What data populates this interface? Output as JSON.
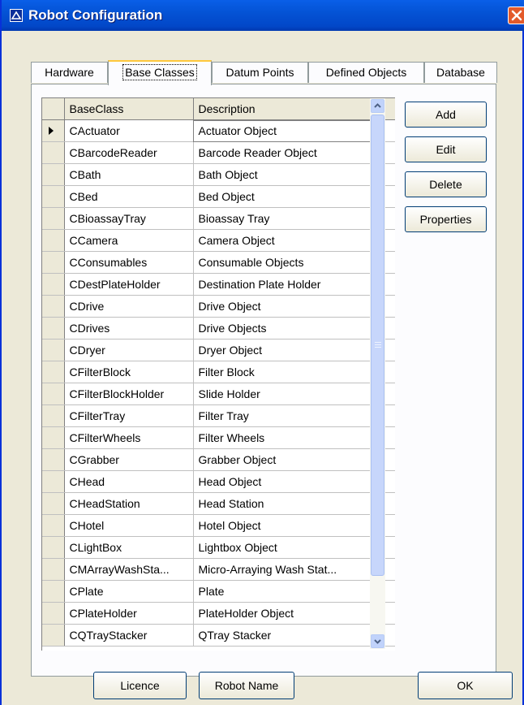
{
  "window": {
    "title": "Robot Configuration"
  },
  "tabs": [
    {
      "label": "Hardware"
    },
    {
      "label": "Base Classes"
    },
    {
      "label": "Datum Points"
    },
    {
      "label": "Defined Objects"
    },
    {
      "label": "Database"
    }
  ],
  "active_tab": "Base Classes",
  "grid": {
    "columns": [
      "BaseClass",
      "Description"
    ],
    "rows": [
      [
        "CActuator",
        "Actuator Object"
      ],
      [
        "CBarcodeReader",
        "Barcode Reader Object"
      ],
      [
        "CBath",
        "Bath Object"
      ],
      [
        "CBed",
        "Bed Object"
      ],
      [
        "CBioassayTray",
        "Bioassay Tray"
      ],
      [
        "CCamera",
        "Camera Object"
      ],
      [
        "CConsumables",
        "Consumable Objects"
      ],
      [
        "CDestPlateHolder",
        "Destination Plate Holder"
      ],
      [
        "CDrive",
        "Drive Object"
      ],
      [
        "CDrives",
        "Drive Objects"
      ],
      [
        "CDryer",
        "Dryer Object"
      ],
      [
        "CFilterBlock",
        "Filter Block"
      ],
      [
        "CFilterBlockHolder",
        "Slide Holder"
      ],
      [
        "CFilterTray",
        "Filter Tray"
      ],
      [
        "CFilterWheels",
        "Filter Wheels"
      ],
      [
        "CGrabber",
        "Grabber Object"
      ],
      [
        "CHead",
        "Head Object"
      ],
      [
        "CHeadStation",
        "Head Station"
      ],
      [
        "CHotel",
        "Hotel Object"
      ],
      [
        "CLightBox",
        "Lightbox Object"
      ],
      [
        "CMArrayWashSta...",
        "Micro-Arraying Wash Stat..."
      ],
      [
        "CPlate",
        "Plate"
      ],
      [
        "CPlateHolder",
        "PlateHolder Object"
      ],
      [
        "CQTrayStacker",
        "QTray Stacker"
      ]
    ]
  },
  "side_buttons": {
    "add": "Add",
    "edit": "Edit",
    "delete": "Delete",
    "properties": "Properties"
  },
  "bottom_buttons": {
    "licence": "Licence",
    "robot_name": "Robot Name",
    "ok": "OK"
  },
  "icons": {
    "title": "window-app-icon",
    "close": "close-icon",
    "row_pointer": "row-pointer-icon",
    "scroll_up": "scroll-up-arrow-icon",
    "scroll_down": "scroll-down-arrow-icon"
  },
  "colors": {
    "titlebar": "#0453d5",
    "dialog_bg": "#ece9d8",
    "close": "#e35a2b",
    "active_tab_accent": "#ffc83c"
  }
}
